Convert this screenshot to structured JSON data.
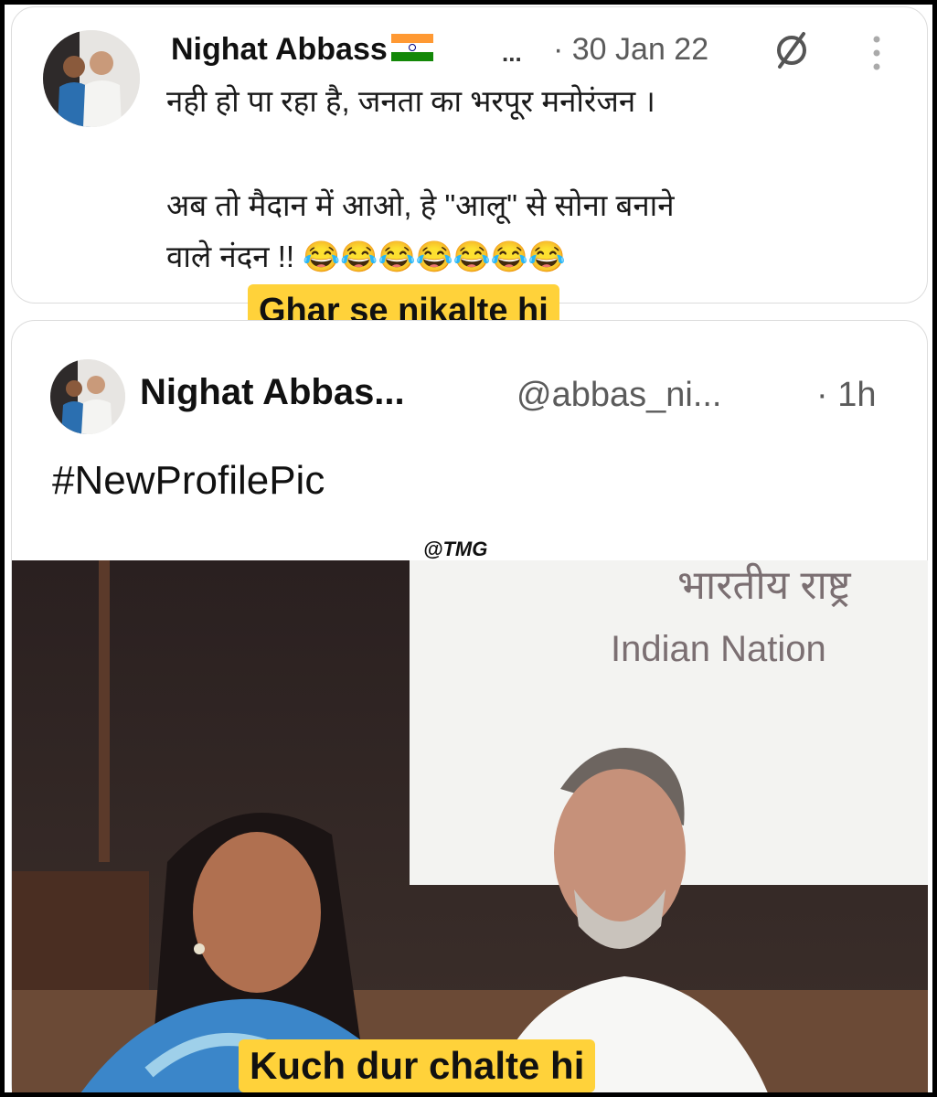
{
  "top_tweet": {
    "author_name": "Nighat Abbass",
    "flag_icon": "india-flag-icon",
    "ellipsis": "...",
    "timestamp": "· 30 Jan 22",
    "line1": "नही हो पा रहा है, जनता का भरपूर मनोरंजन ।",
    "line2": "अब तो मैदान में आओ, हे \"आलू\" से सोना बनाने",
    "line3": "वाले नंदन !! 😂😂😂😂😂😂😂"
  },
  "caption_top": "Ghar se nikalte hi",
  "bottom_tweet": {
    "author_name": "Nighat Abbas...",
    "handle": "@abbas_ni...",
    "time": "· 1h",
    "text": "#NewProfilePic"
  },
  "watermark": "@TMG",
  "photo": {
    "sign_hindi": "भारतीय राष्ट्र",
    "sign_english": "Indian Nation"
  },
  "caption_bottom": "Kuch dur chalte hi"
}
